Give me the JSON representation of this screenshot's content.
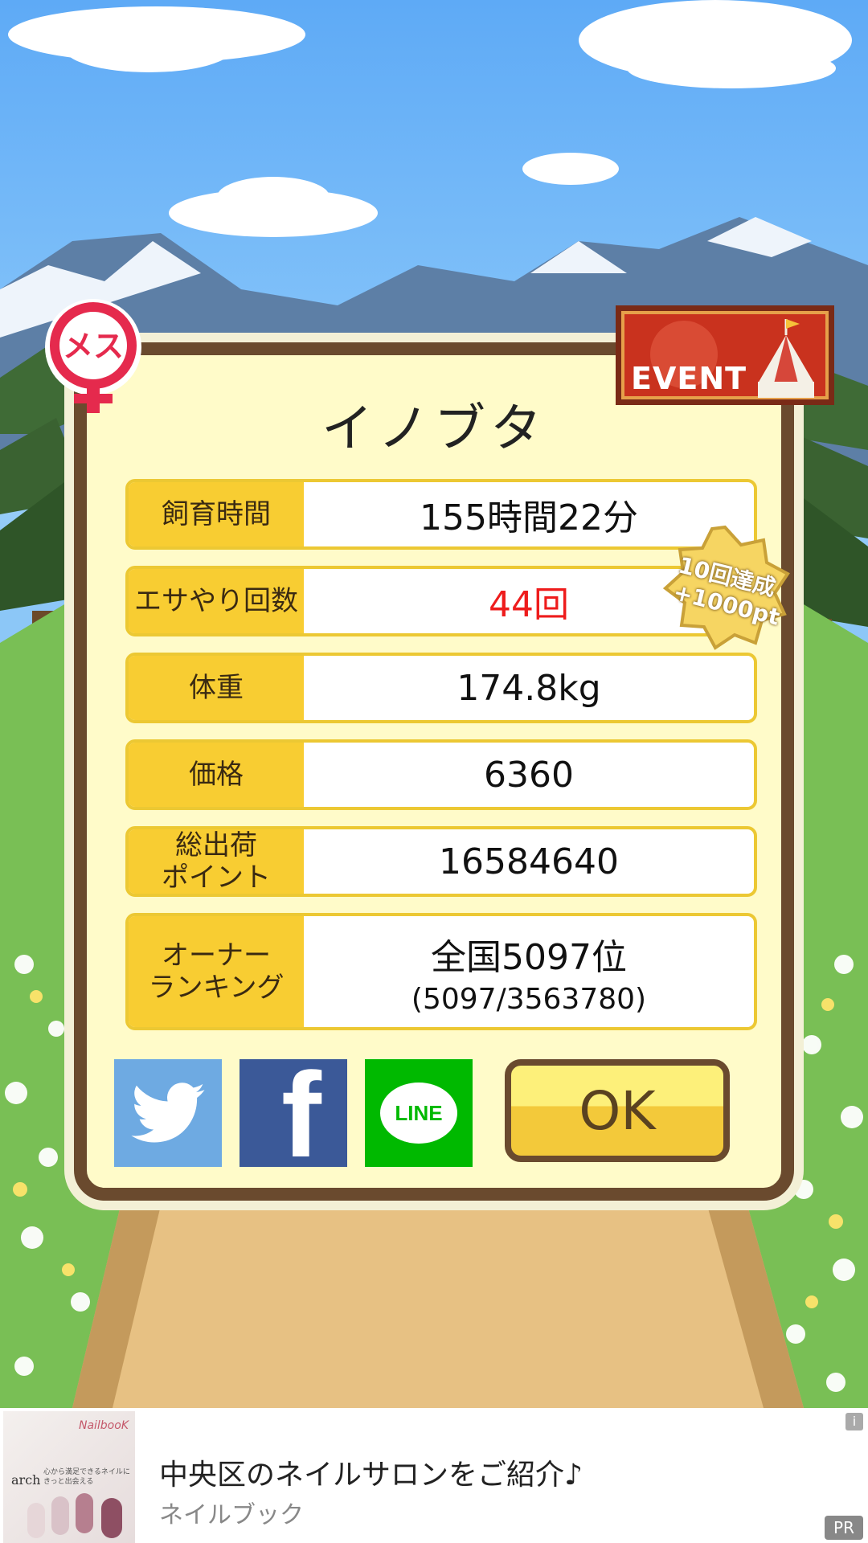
{
  "gender": {
    "label": "メス"
  },
  "event": {
    "label": "EVENT"
  },
  "pig": {
    "name": "イノブタ"
  },
  "stats": [
    {
      "label": "飼育時間",
      "value": "155時間22分"
    },
    {
      "label": "エサやり回数",
      "value": "44回"
    },
    {
      "label": "体重",
      "value": "174.8kg"
    },
    {
      "label": "価格",
      "value": "6360"
    },
    {
      "label_line1": "総出荷",
      "label_line2": "ポイント",
      "value": "16584640"
    },
    {
      "label_line1": "オーナー",
      "label_line2": "ランキング",
      "value": "全国5097位",
      "sub_value": "(5097/3563780)"
    }
  ],
  "achievement": {
    "line1": "10回達成",
    "line2": "+1000pt"
  },
  "share": {
    "line_label": "LINE",
    "facebook_label": "f"
  },
  "buttons": {
    "ok": "OK"
  },
  "ad": {
    "title": "中央区のネイルサロンをご紹介♪",
    "advertiser": "ネイルブック",
    "brand": "arch",
    "brand_tagline": "心から満足できるネイルにきっと出会える",
    "logo_text": "NailbooK",
    "info": "i",
    "pr": "PR"
  },
  "colors": {
    "panel_border": "#6a4a2e",
    "panel_bg": "#fffbc9",
    "label_bg": "#f8cd32",
    "highlight_text": "#ee1c1c",
    "twitter": "#6eaae2",
    "facebook": "#3b5998",
    "line": "#00b900"
  }
}
